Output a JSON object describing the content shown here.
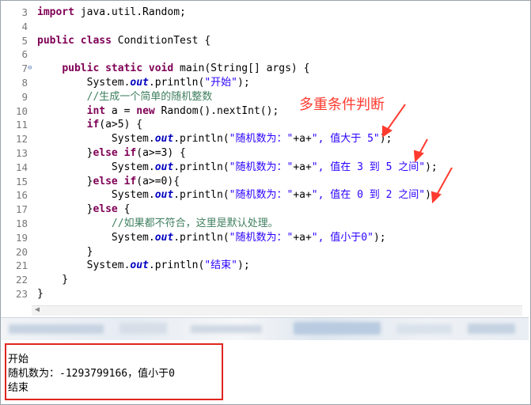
{
  "editor": {
    "lines": [
      {
        "num": "3",
        "segs": [
          [
            "kw",
            "import"
          ],
          [
            "n",
            " java.util.Random;"
          ]
        ]
      },
      {
        "num": "4",
        "segs": []
      },
      {
        "num": "5",
        "segs": [
          [
            "kw",
            "public class"
          ],
          [
            "n",
            " ConditionTest {"
          ]
        ]
      },
      {
        "num": "6",
        "segs": []
      },
      {
        "num": "7",
        "fold": true,
        "segs": [
          [
            "n",
            "    "
          ],
          [
            "kw",
            "public static void"
          ],
          [
            "n",
            " main(String[] args) {"
          ]
        ]
      },
      {
        "num": "8",
        "segs": [
          [
            "n",
            "        System."
          ],
          [
            "fld",
            "out"
          ],
          [
            "n",
            ".println("
          ],
          [
            "str",
            "\"开始\""
          ],
          [
            "n",
            ");"
          ]
        ]
      },
      {
        "num": "9",
        "segs": [
          [
            "n",
            "        "
          ],
          [
            "cmt",
            "//生成一个简单的随机整数"
          ]
        ]
      },
      {
        "num": "10",
        "segs": [
          [
            "n",
            "        "
          ],
          [
            "kw",
            "int"
          ],
          [
            "n",
            " a = "
          ],
          [
            "kw",
            "new"
          ],
          [
            "n",
            " Random().nextInt();"
          ]
        ]
      },
      {
        "num": "11",
        "segs": [
          [
            "n",
            "        "
          ],
          [
            "kw",
            "if"
          ],
          [
            "n",
            "(a>5) {"
          ]
        ]
      },
      {
        "num": "12",
        "segs": [
          [
            "n",
            "            System."
          ],
          [
            "fld",
            "out"
          ],
          [
            "n",
            ".println("
          ],
          [
            "str",
            "\"随机数为：\""
          ],
          [
            "n",
            "+a+"
          ],
          [
            "str",
            "\", 值大于 5\""
          ],
          [
            "n",
            ");"
          ]
        ]
      },
      {
        "num": "13",
        "segs": [
          [
            "n",
            "        }"
          ],
          [
            "kw",
            "else if"
          ],
          [
            "n",
            "(a>=3) {"
          ]
        ]
      },
      {
        "num": "14",
        "segs": [
          [
            "n",
            "            System."
          ],
          [
            "fld",
            "out"
          ],
          [
            "n",
            ".println("
          ],
          [
            "str",
            "\"随机数为：\""
          ],
          [
            "n",
            "+a+"
          ],
          [
            "str",
            "\", 值在 3 到 5 之间\""
          ],
          [
            "n",
            ");"
          ]
        ]
      },
      {
        "num": "15",
        "segs": [
          [
            "n",
            "        }"
          ],
          [
            "kw",
            "else if"
          ],
          [
            "n",
            "(a>=0){"
          ]
        ]
      },
      {
        "num": "16",
        "segs": [
          [
            "n",
            "            System."
          ],
          [
            "fld",
            "out"
          ],
          [
            "n",
            ".println("
          ],
          [
            "str",
            "\"随机数为：\""
          ],
          [
            "n",
            "+a+"
          ],
          [
            "str",
            "\", 值在 0 到 2 之间\""
          ],
          [
            "n",
            ");"
          ]
        ]
      },
      {
        "num": "17",
        "segs": [
          [
            "n",
            "        }"
          ],
          [
            "kw",
            "else"
          ],
          [
            "n",
            " {"
          ]
        ]
      },
      {
        "num": "18",
        "segs": [
          [
            "n",
            "            "
          ],
          [
            "cmt",
            "//如果都不符合，这里是默认处理。"
          ]
        ]
      },
      {
        "num": "19",
        "segs": [
          [
            "n",
            "            System."
          ],
          [
            "fld",
            "out"
          ],
          [
            "n",
            ".println("
          ],
          [
            "str",
            "\"随机数为：\""
          ],
          [
            "n",
            "+a+"
          ],
          [
            "str",
            "\", 值小于0\""
          ],
          [
            "n",
            ");"
          ]
        ]
      },
      {
        "num": "20",
        "segs": [
          [
            "n",
            "        }"
          ]
        ]
      },
      {
        "num": "21",
        "segs": [
          [
            "n",
            "        System."
          ],
          [
            "fld",
            "out"
          ],
          [
            "n",
            ".println("
          ],
          [
            "str",
            "\"结束\""
          ],
          [
            "n",
            ");"
          ]
        ]
      },
      {
        "num": "22",
        "segs": [
          [
            "n",
            "    }"
          ]
        ]
      },
      {
        "num": "23",
        "segs": [
          [
            "n",
            "}"
          ]
        ]
      }
    ]
  },
  "annotation": {
    "text": "多重条件判断",
    "color": "#ff3b2f"
  },
  "console": {
    "lines": [
      "开始",
      "随机数为：-1293799166，值小于0",
      "结束"
    ]
  },
  "colors": {
    "highlight_box": "#e0251d",
    "keyword": "#7f0055",
    "string": "#2a00ff",
    "comment": "#3f7f5f"
  }
}
